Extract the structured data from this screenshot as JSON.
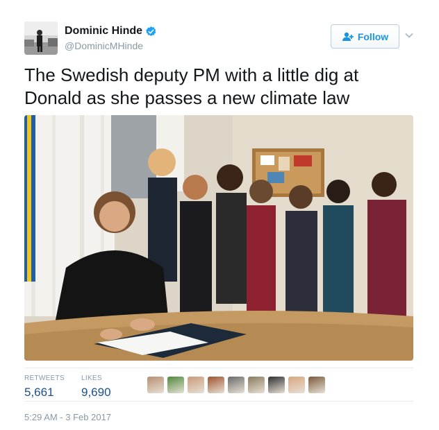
{
  "author": {
    "display_name": "Dominic Hinde",
    "handle": "@DominicMHinde",
    "verified": true
  },
  "actions": {
    "follow_label": "Follow"
  },
  "tweet": {
    "text": "The Swedish deputy PM with a little dig at Donald as she passes a new climate law"
  },
  "stats": {
    "retweets_label": "RETWEETS",
    "retweets_value": "5,661",
    "likes_label": "LIKES",
    "likes_value": "9,690"
  },
  "likers": [
    {
      "color": "#b58f72"
    },
    {
      "color": "#4d8a3a"
    },
    {
      "color": "#c99a7a"
    },
    {
      "color": "#a0522d"
    },
    {
      "color": "#6b6b6b"
    },
    {
      "color": "#8a7b5c"
    },
    {
      "color": "#2f2f2f"
    },
    {
      "color": "#d9a57e"
    },
    {
      "color": "#7a5a3a"
    }
  ],
  "timestamp": "5:29 AM - 3 Feb 2017",
  "colors": {
    "accent": "#1b95e0",
    "stat_value": "#1d4f8f",
    "muted": "#8899a6"
  }
}
